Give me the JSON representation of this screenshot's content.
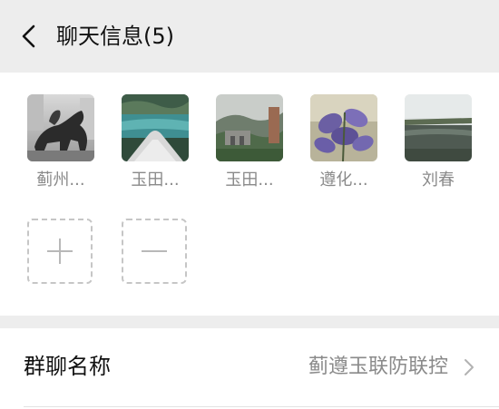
{
  "header": {
    "title": "聊天信息(5)"
  },
  "members": [
    {
      "name": "蓟州...",
      "avatar_icon": "bull-statue-photo"
    },
    {
      "name": "玉田...",
      "avatar_icon": "lake-reflection-photo"
    },
    {
      "name": "玉田...",
      "avatar_icon": "mountain-gate-photo"
    },
    {
      "name": "遵化...",
      "avatar_icon": "purple-leaves-photo"
    },
    {
      "name": "刘春",
      "avatar_icon": "river-landscape-photo"
    }
  ],
  "actions": {
    "add_icon": "plus-icon",
    "remove_icon": "minus-icon"
  },
  "group_name_row": {
    "label": "群聊名称",
    "value": "蓟遵玉联防联控"
  }
}
